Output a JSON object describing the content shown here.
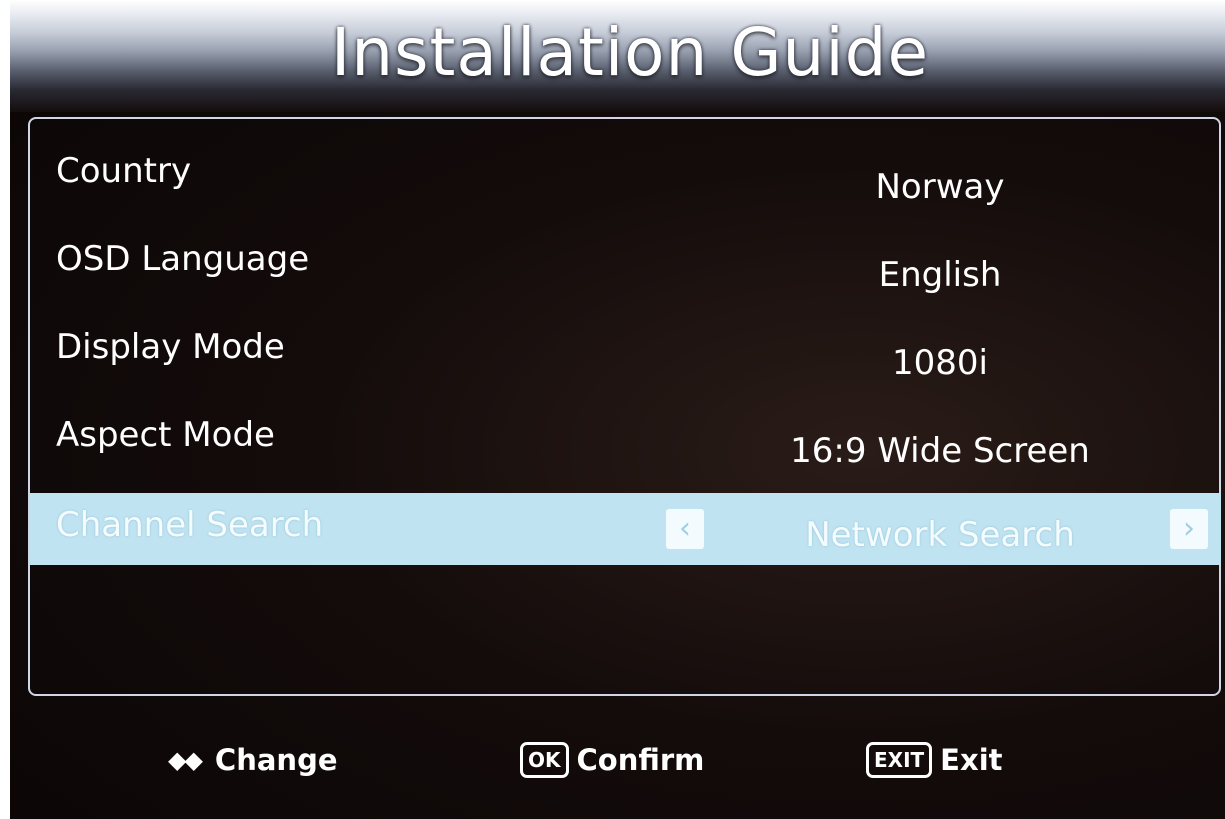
{
  "title": "Installation Guide",
  "settings": [
    {
      "label": "Country",
      "value": "Norway"
    },
    {
      "label": "OSD Language",
      "value": "English"
    },
    {
      "label": "Display Mode",
      "value": "1080i"
    },
    {
      "label": "Aspect Mode",
      "value": "16:9 Wide Screen"
    },
    {
      "label": "Channel Search",
      "value": "Network Search"
    }
  ],
  "selected_row": "Channel Search",
  "selector": {
    "left_arrow": "‹",
    "right_arrow": "›"
  },
  "footer": {
    "change_icon": "◆◆",
    "change_label": "Change",
    "ok_key": "OK",
    "confirm_label": "Confirm",
    "exit_key": "EXIT",
    "exit_label": "Exit"
  },
  "colors": {
    "highlight": "#bfe3f1",
    "panel_border": "#cfd6e6",
    "background": "#140c0b"
  }
}
